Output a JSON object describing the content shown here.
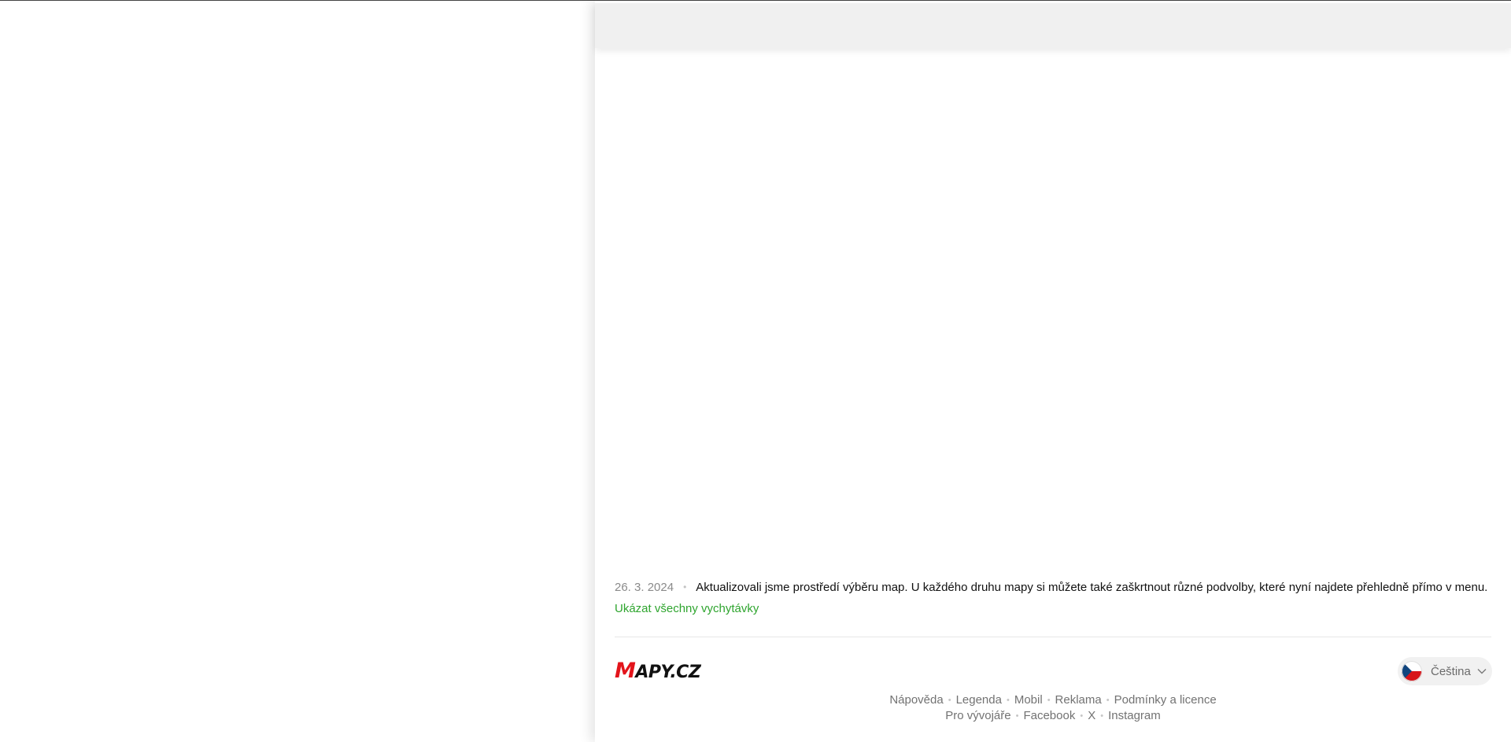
{
  "tips": {
    "date": "26. 3. 2024",
    "text": "Aktualizovali jsme prostředí výběru map. U každého druhu mapy si můžete také zaškrtnout různé podvolby, které nyní najdete přehledně přímo v menu.",
    "show_all_link": "Ukázat všechny vychytávky"
  },
  "footer": {
    "logo": {
      "first_letter": "M",
      "rest": "APY.CZ"
    },
    "language": {
      "label": "Čeština",
      "flag_icon": "czech-flag-icon"
    },
    "links_row1": [
      "Nápověda",
      "Legenda",
      "Mobil",
      "Reklama",
      "Podmínky a licence"
    ],
    "links_row2": [
      "Pro vývojáře",
      "Facebook",
      "X",
      "Instagram"
    ]
  },
  "colors": {
    "link_green": "#2fa52f",
    "logo_red": "#e3141b",
    "header_gray": "#f0f0f0"
  }
}
